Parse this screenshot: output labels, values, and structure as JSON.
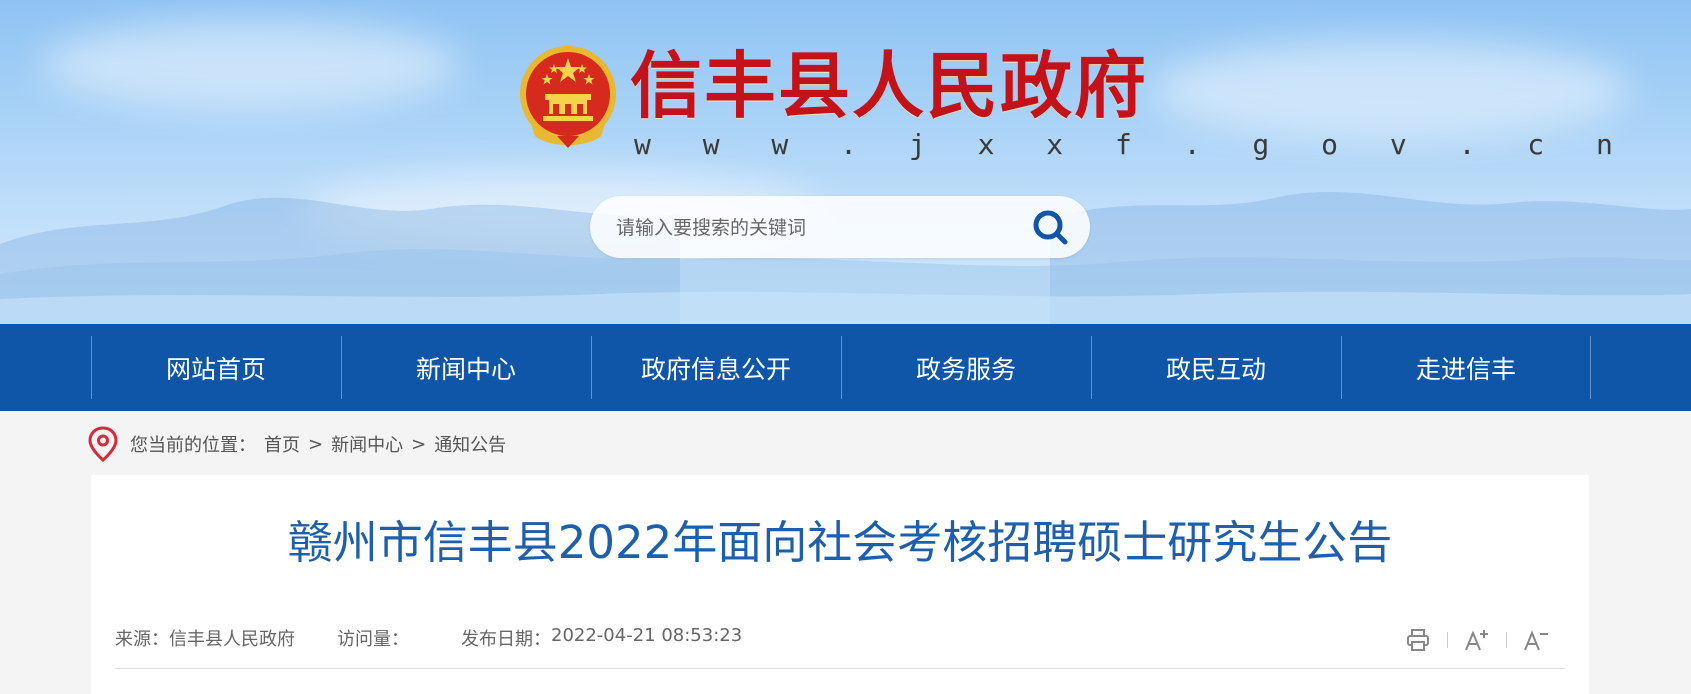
{
  "header": {
    "site_title": "信丰县人民政府",
    "site_url": "w w w . j x x f . g o v . c n",
    "search": {
      "placeholder": "请输入要搜索的关键词"
    }
  },
  "nav": {
    "items": [
      "网站首页",
      "新闻中心",
      "政府信息公开",
      "政务服务",
      "政民互动",
      "走进信丰"
    ]
  },
  "breadcrumb": {
    "label": "您当前的位置：",
    "items": [
      "首页",
      "新闻中心",
      "通知公告"
    ],
    "separator": ">"
  },
  "article": {
    "title": "赣州市信丰县2022年面向社会考核招聘硕士研究生公告",
    "source_label": "来源：",
    "source": "信丰县人民政府",
    "views_label": "访问量：",
    "views": "",
    "date_label": "发布日期：",
    "date": "2022-04-21 08:53:23"
  },
  "colors": {
    "nav_bg": "#1056a8",
    "title_red": "#c4121a",
    "article_title": "#1d5fad",
    "pin_red": "#d9283a"
  },
  "icons": {
    "search": "search-icon",
    "location": "location-pin-icon",
    "print": "print-icon",
    "font_increase": "font-increase-icon",
    "font_decrease": "font-decrease-icon"
  }
}
